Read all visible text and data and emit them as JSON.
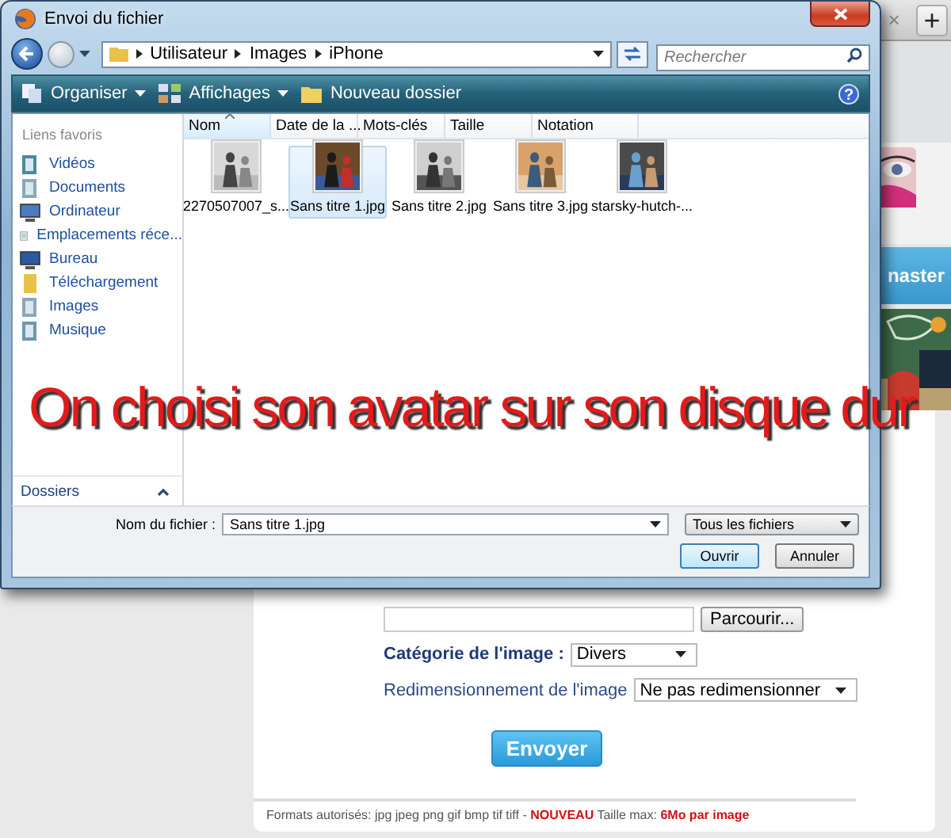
{
  "browser": {
    "tab_close": "×",
    "new_tab": "+"
  },
  "page": {
    "nav_label": "naster",
    "form": [
      {
        "kind": "file",
        "button": "Parcourir..."
      },
      {
        "kind": "select",
        "label": "Catégorie de l'image :",
        "value": "Divers",
        "bold": true
      },
      {
        "kind": "select",
        "label": "Redimensionnement de l'image",
        "value": "Ne pas redimensionner",
        "bold": false
      }
    ],
    "submit": "Envoyer",
    "footer": "Formats autorisés: jpg jpeg png gif bmp tif tiff - **NOUVEAU** Taille max: **6Mo par image**"
  },
  "dialog": {
    "title": "Envoi du fichier",
    "path": [
      "Utilisateur",
      "Images",
      "iPhone"
    ],
    "search_placeholder": "Rechercher",
    "toolbar": [
      {
        "kind": "organize",
        "label": "Organiser",
        "menu": true
      },
      {
        "kind": "views",
        "label": "Affichages",
        "menu": true
      },
      {
        "kind": "new-folder",
        "label": "Nouveau dossier",
        "menu": false
      }
    ],
    "help": "?",
    "favorites_heading": "Liens favoris",
    "favorites": [
      {
        "kind": "videos",
        "label": "Vidéos"
      },
      {
        "kind": "documents",
        "label": "Documents"
      },
      {
        "kind": "computer",
        "label": "Ordinateur"
      },
      {
        "kind": "recent",
        "label": "Emplacements réce..."
      },
      {
        "kind": "desktop",
        "label": "Bureau"
      },
      {
        "kind": "downloads",
        "label": "Téléchargement"
      },
      {
        "kind": "pictures",
        "label": "Images"
      },
      {
        "kind": "music",
        "label": "Musique"
      }
    ],
    "folders_label": "Dossiers",
    "columns": [
      {
        "label": "Nom",
        "sorted": true
      },
      {
        "label": "Date de la ...",
        "sorted": false
      },
      {
        "label": "Mots-clés",
        "sorted": false
      },
      {
        "label": "Taille",
        "sorted": false
      },
      {
        "label": "Notation",
        "sorted": false
      }
    ],
    "files": [
      {
        "name": "2270507007_s...",
        "selected": false
      },
      {
        "name": "Sans titre 1.jpg",
        "selected": true
      },
      {
        "name": "Sans titre 2.jpg",
        "selected": false
      },
      {
        "name": "Sans titre 3.jpg",
        "selected": false
      },
      {
        "name": "starsky-hutch-...",
        "selected": false
      }
    ],
    "filename_label": "Nom du fichier :",
    "filename_value": "Sans titre 1.jpg",
    "filter": "Tous les fichiers",
    "buttons": [
      {
        "label": "Ouvrir",
        "default": true
      },
      {
        "label": "Annuler",
        "default": false
      }
    ]
  },
  "caption": "On choisi son avatar sur son disque dur"
}
